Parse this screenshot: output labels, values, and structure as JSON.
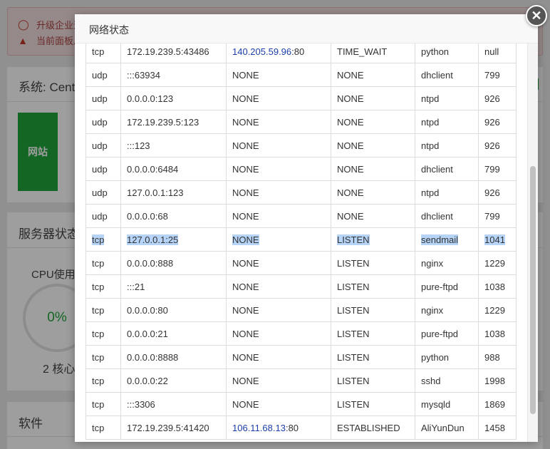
{
  "alert": {
    "line1": "升级企业运",
    "line2": "当前面板用"
  },
  "system_panel": {
    "title": "系统: CentO",
    "tile_label": "网站"
  },
  "server_panel": {
    "title": "服务器状态",
    "cpu_label": "CPU使用",
    "cpu_value": "0%",
    "cores": "2 核心"
  },
  "software_panel": {
    "title": "软件"
  },
  "modal": {
    "title": "网络状态",
    "close_label": "✕",
    "rows": [
      {
        "proto": "tcp",
        "local": "172.19.239.5:43486",
        "remote_ip": "140.205.59.96",
        "remote_port": ":80",
        "state": "TIME_WAIT",
        "process": "python",
        "pid": "null"
      },
      {
        "proto": "udp",
        "local": ":::63934",
        "remote_ip": "",
        "remote_port": "NONE",
        "state": "NONE",
        "process": "dhclient",
        "pid": "799"
      },
      {
        "proto": "udp",
        "local": "0.0.0.0:123",
        "remote_ip": "",
        "remote_port": "NONE",
        "state": "NONE",
        "process": "ntpd",
        "pid": "926"
      },
      {
        "proto": "udp",
        "local": "172.19.239.5:123",
        "remote_ip": "",
        "remote_port": "NONE",
        "state": "NONE",
        "process": "ntpd",
        "pid": "926"
      },
      {
        "proto": "udp",
        "local": ":::123",
        "remote_ip": "",
        "remote_port": "NONE",
        "state": "NONE",
        "process": "ntpd",
        "pid": "926"
      },
      {
        "proto": "udp",
        "local": "0.0.0.0:6484",
        "remote_ip": "",
        "remote_port": "NONE",
        "state": "NONE",
        "process": "dhclient",
        "pid": "799"
      },
      {
        "proto": "udp",
        "local": "127.0.0.1:123",
        "remote_ip": "",
        "remote_port": "NONE",
        "state": "NONE",
        "process": "ntpd",
        "pid": "926"
      },
      {
        "proto": "udp",
        "local": "0.0.0.0:68",
        "remote_ip": "",
        "remote_port": "NONE",
        "state": "NONE",
        "process": "dhclient",
        "pid": "799"
      },
      {
        "proto": "tcp",
        "local": "127.0.0.1:25",
        "remote_ip": "",
        "remote_port": "NONE",
        "state": "LISTEN",
        "process": "sendmail",
        "pid": "1041",
        "selected": true
      },
      {
        "proto": "tcp",
        "local": "0.0.0.0:888",
        "remote_ip": "",
        "remote_port": "NONE",
        "state": "LISTEN",
        "process": "nginx",
        "pid": "1229"
      },
      {
        "proto": "tcp",
        "local": ":::21",
        "remote_ip": "",
        "remote_port": "NONE",
        "state": "LISTEN",
        "process": "pure-ftpd",
        "pid": "1038"
      },
      {
        "proto": "tcp",
        "local": "0.0.0.0:80",
        "remote_ip": "",
        "remote_port": "NONE",
        "state": "LISTEN",
        "process": "nginx",
        "pid": "1229"
      },
      {
        "proto": "tcp",
        "local": "0.0.0.0:21",
        "remote_ip": "",
        "remote_port": "NONE",
        "state": "LISTEN",
        "process": "pure-ftpd",
        "pid": "1038"
      },
      {
        "proto": "tcp",
        "local": "0.0.0.0:8888",
        "remote_ip": "",
        "remote_port": "NONE",
        "state": "LISTEN",
        "process": "python",
        "pid": "988"
      },
      {
        "proto": "tcp",
        "local": "0.0.0.0:22",
        "remote_ip": "",
        "remote_port": "NONE",
        "state": "LISTEN",
        "process": "sshd",
        "pid": "1998"
      },
      {
        "proto": "tcp",
        "local": ":::3306",
        "remote_ip": "",
        "remote_port": "NONE",
        "state": "LISTEN",
        "process": "mysqld",
        "pid": "1869"
      },
      {
        "proto": "tcp",
        "local": "172.19.239.5:41420",
        "remote_ip": "106.11.68.13",
        "remote_port": ":80",
        "state": "ESTABLISHED",
        "process": "AliYunDun",
        "pid": "1458"
      }
    ]
  },
  "colors": {
    "accent_green": "#20a53a",
    "alert_red": "#a94442",
    "link_blue": "#1a3fa8",
    "selection": "#b6d4f7"
  }
}
